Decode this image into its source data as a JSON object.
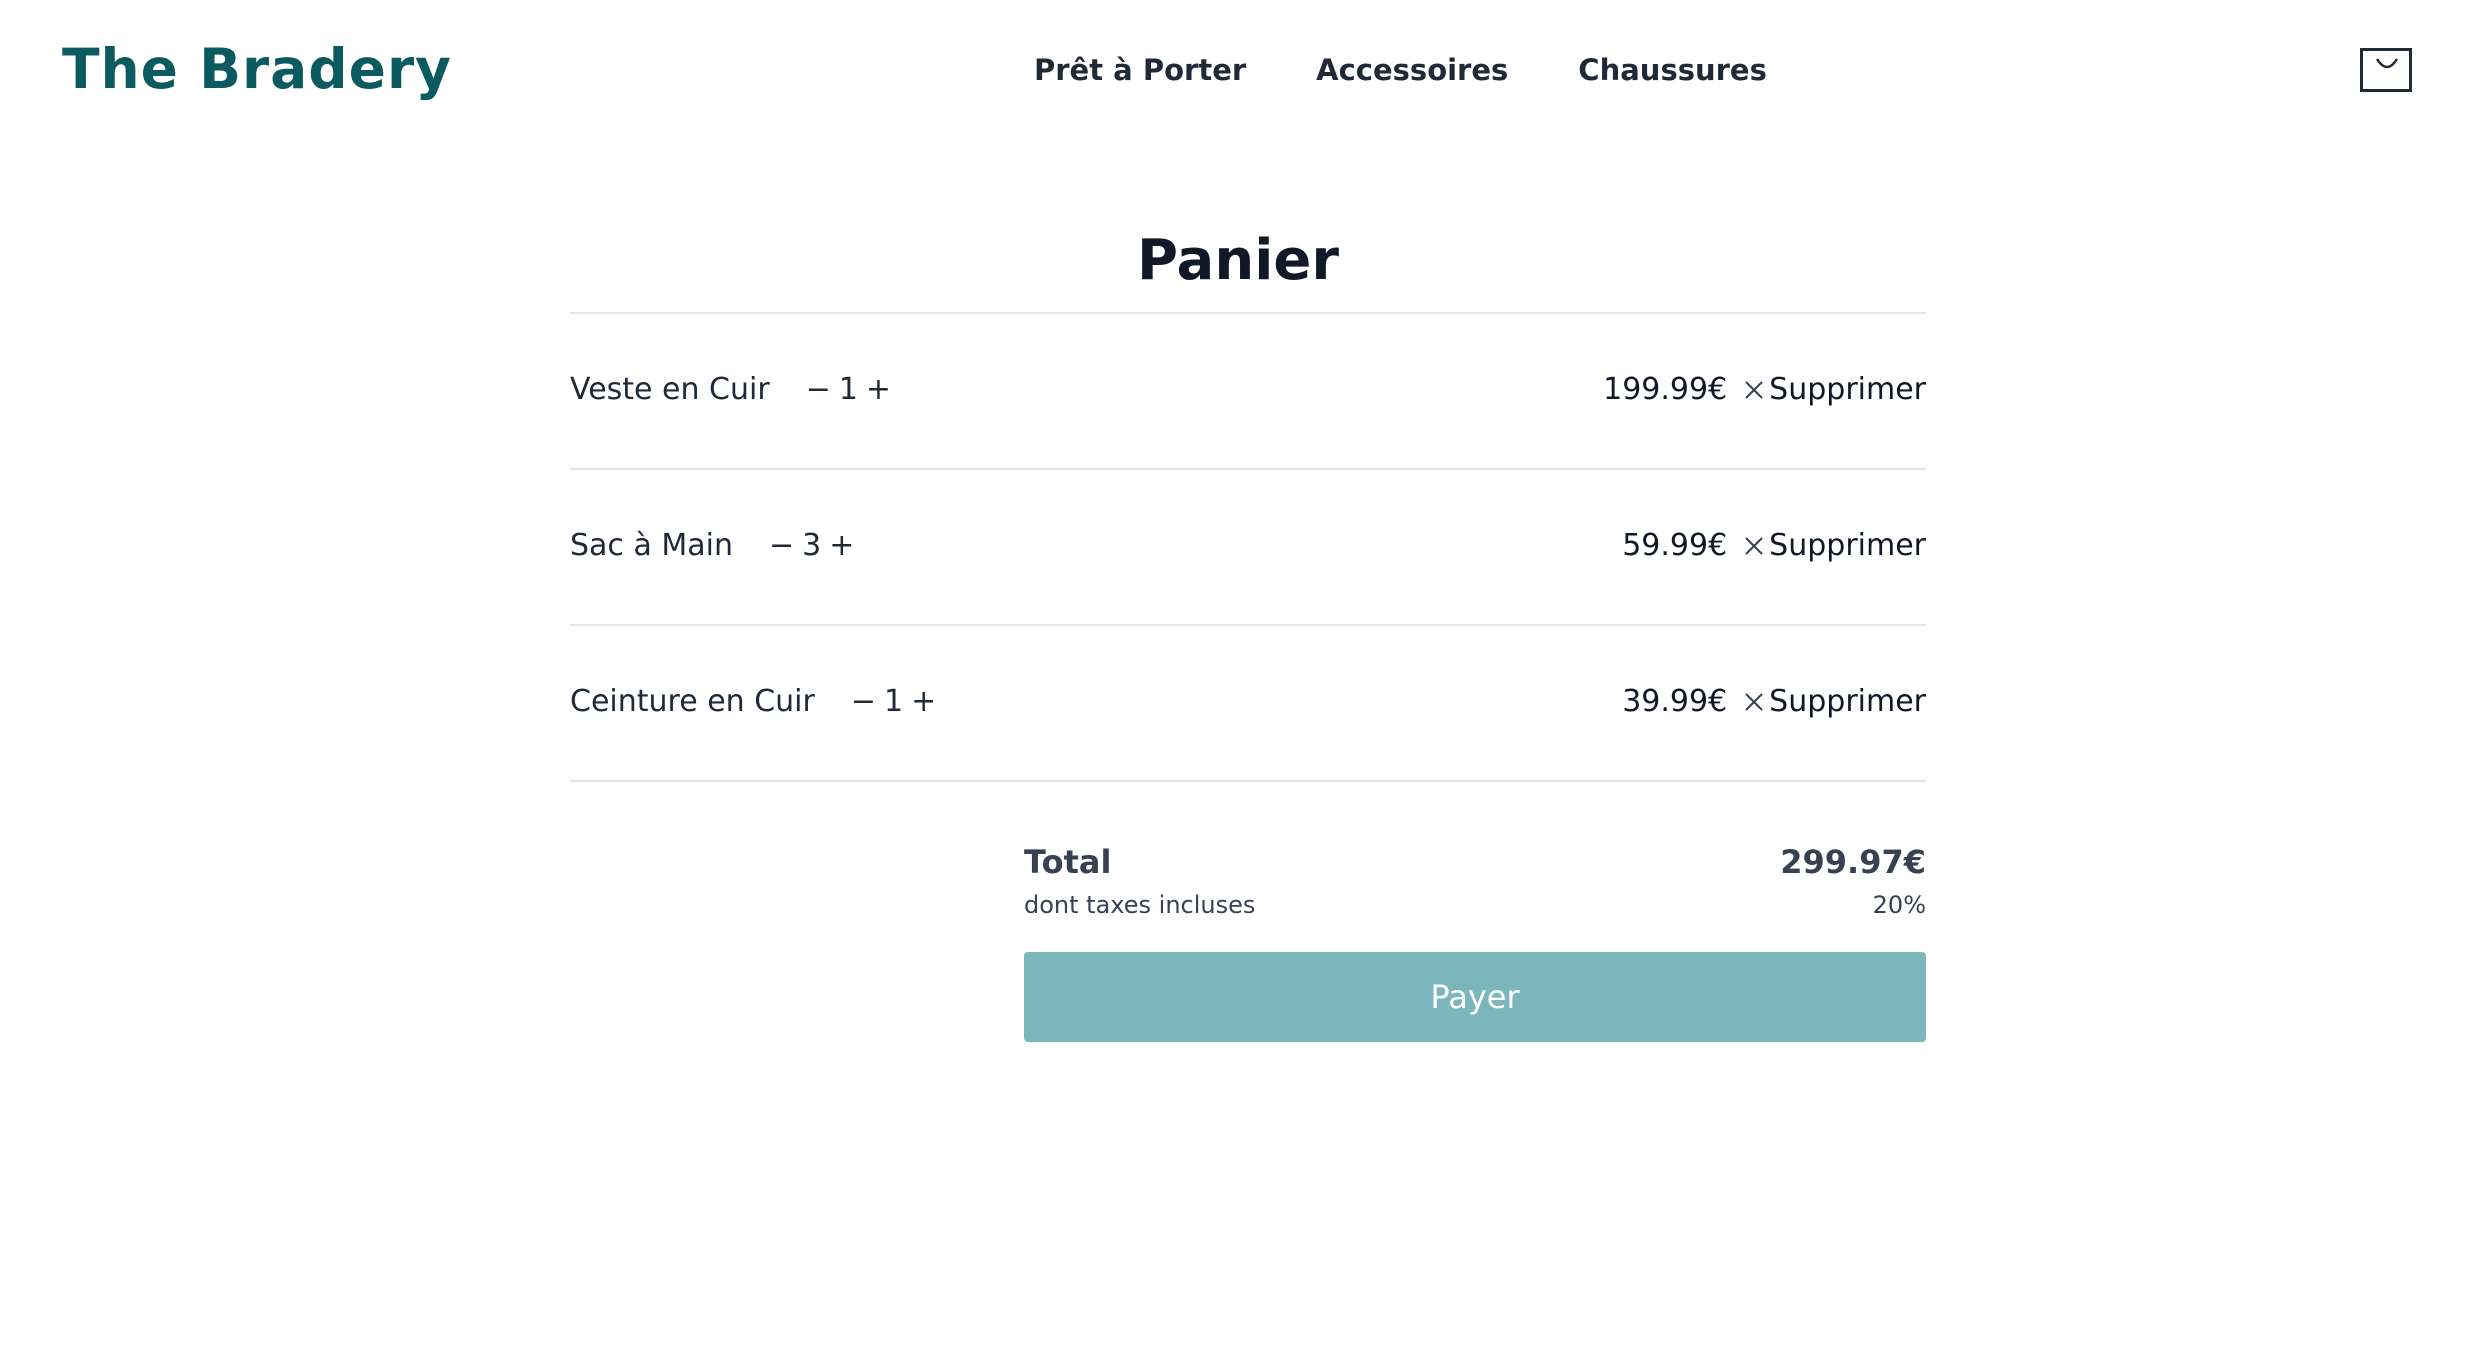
{
  "header": {
    "logo": "The Bradery",
    "nav": [
      "Prêt à Porter",
      "Accessoires",
      "Chaussures"
    ],
    "cart_icon": "shopping-bag-icon"
  },
  "page": {
    "title": "Panier"
  },
  "cart": {
    "items": [
      {
        "name": "Veste en Cuir",
        "qty": "1",
        "price": "199.99€",
        "remove_label": "Supprimer"
      },
      {
        "name": "Sac à Main",
        "qty": "3",
        "price": "59.99€",
        "remove_label": "Supprimer"
      },
      {
        "name": "Ceinture en Cuir",
        "qty": "1",
        "price": "39.99€",
        "remove_label": "Supprimer"
      }
    ],
    "decrement_symbol": "−",
    "increment_symbol": "+"
  },
  "summary": {
    "total_label": "Total",
    "total_value": "299.97€",
    "tax_label": "dont taxes incluses",
    "tax_value": "20%",
    "pay_label": "Payer"
  },
  "colors": {
    "brand": "#0b5a5f",
    "pay_button": "#7bb6bd",
    "divider": "#e5e7eb"
  }
}
